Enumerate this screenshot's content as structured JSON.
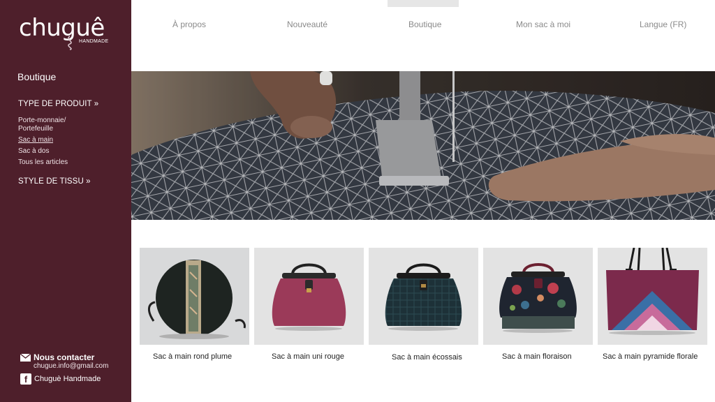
{
  "brand": {
    "name": "chuguê",
    "tagline": "HANDMADE"
  },
  "sidebar": {
    "title": "Boutique",
    "section1": "TYPE DE PRODUIT »",
    "links": [
      {
        "label": "Porte-monnaie/ Portefeuille",
        "active": false
      },
      {
        "label": "Sac à main",
        "active": true
      },
      {
        "label": "Sac à dos",
        "active": false
      },
      {
        "label": "Tous les articles",
        "active": false
      }
    ],
    "section2": "STYLE DE TISSU »"
  },
  "contact": {
    "title": "Nous contacter",
    "email": "chugue.info@gmail.com",
    "facebook": "Chuguè Handmade"
  },
  "nav": {
    "items": [
      {
        "label": "À propos"
      },
      {
        "label": "Nouveauté"
      },
      {
        "label": "Boutique",
        "active": true
      },
      {
        "label": "Mon sac à moi"
      },
      {
        "label": "Langue (FR)"
      }
    ]
  },
  "products": [
    {
      "name": "Sac à main rond plume",
      "icon": "round-bag"
    },
    {
      "name": "Sac à main uni rouge",
      "icon": "doctor-bag-red"
    },
    {
      "name": "Sac à main écossais",
      "icon": "doctor-bag-tartan"
    },
    {
      "name": "Sac à main floraison",
      "icon": "doctor-bag-floral"
    },
    {
      "name": "Sac à main pyramide florale",
      "icon": "tote-bag-pyramid"
    }
  ],
  "colors": {
    "sidebar": "#4e1f2b",
    "nav_text": "#8a8a8a",
    "product_bg": "#e4e4e4"
  }
}
